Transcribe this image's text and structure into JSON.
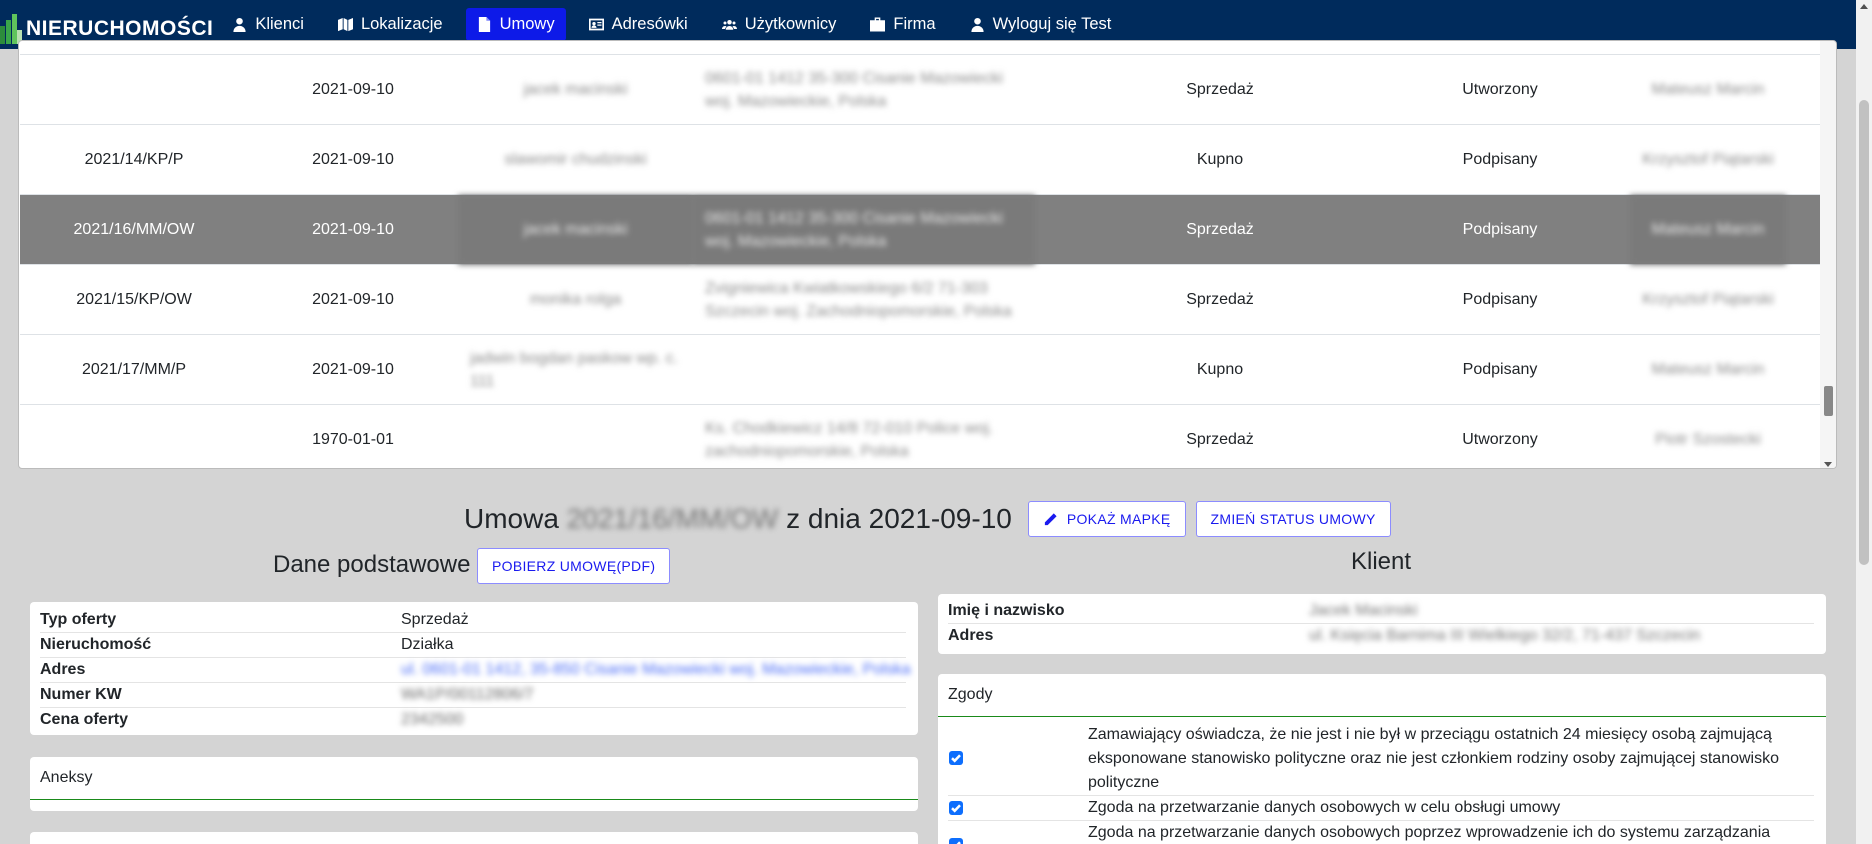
{
  "nav": {
    "brand": "NIERUCHOMOŚCI",
    "items": [
      {
        "label": "Klienci",
        "icon": "user-icon"
      },
      {
        "label": "Lokalizacje",
        "icon": "map-icon"
      },
      {
        "label": "Umowy",
        "icon": "file-icon",
        "active": true
      },
      {
        "label": "Adresówki",
        "icon": "address-card-icon"
      },
      {
        "label": "Użytkownicy",
        "icon": "users-icon"
      },
      {
        "label": "Firma",
        "icon": "briefcase-icon"
      },
      {
        "label": "Wyloguj się Test",
        "icon": "user-icon"
      }
    ]
  },
  "table": {
    "rows": [
      {
        "number": "",
        "date": "2021-09-10",
        "client": "jacek macinski",
        "address": "0601-01 1412 35-300 Cisanie Mazowiecki woj. Mazowieckie, Polska",
        "type": "Sprzedaż",
        "status": "Utworzony",
        "agent": "Mateusz Marcin"
      },
      {
        "number": "2021/14/KP/P",
        "date": "2021-09-10",
        "client": "slawomir chudzinski",
        "address": "",
        "type": "Kupno",
        "status": "Podpisany",
        "agent": "Krzysztof Piątarski"
      },
      {
        "number": "2021/16/MM/OW",
        "date": "2021-09-10",
        "client": "jacek macinski",
        "address": "0601-01 1412 35-300 Cisanie Mazowiecki woj. Mazowieckie, Polska",
        "type": "Sprzedaż",
        "status": "Podpisany",
        "agent": "Mateusz Marcin",
        "selected": true
      },
      {
        "number": "2021/15/KP/OW",
        "date": "2021-09-10",
        "client": "monika rolga",
        "address": "Zvigniewica Kwiatkowskiego 6/2 71-303 Szczecin woj. Zachodniopomorskie, Polska",
        "type": "Sprzedaż",
        "status": "Podpisany",
        "agent": "Krzysztof Piątarski"
      },
      {
        "number": "2021/17/MM/P",
        "date": "2021-09-10",
        "client": "jadwin bogdan paskow wp. c. 111",
        "address": "",
        "type": "Kupno",
        "status": "Podpisany",
        "agent": "Mateusz Marcin"
      },
      {
        "number": "",
        "date": "1970-01-01",
        "client": "",
        "address": "Ks. Chodkiewicz 14/8 72-010 Police woj. zachodniopomorskie, Polska",
        "type": "Sprzedaż",
        "status": "Utworzony",
        "agent": "Piotr Szostecki"
      }
    ]
  },
  "detail": {
    "title_prefix": "Umowa",
    "title_number": "2021/16/MM/OW",
    "title_suffix": "z dnia 2021-09-10",
    "show_map_button": "POKAŻ MAPKĘ",
    "change_status_button": "ZMIEŃ STATUS UMOWY",
    "basic_heading": "Dane podstawowe",
    "download_button": "POBIERZ UMOWĘ(PDF)",
    "client_heading": "Klient",
    "basic": [
      {
        "label": "Typ oferty",
        "value": "Sprzedaż"
      },
      {
        "label": "Nieruchomość",
        "value": "Działka"
      },
      {
        "label": "Adres",
        "value": "ul. 0601-01 1412, 35-850 Cisanie Mazowiecki woj. Mazowieckie, Polska"
      },
      {
        "label": "Numer KW",
        "value": "WA1P/00112806/7"
      },
      {
        "label": "Cena oferty",
        "value": "2342500"
      }
    ],
    "annex_label": "Aneksy",
    "client": [
      {
        "label": "Imię i nazwisko",
        "value": "Jacek Macinski"
      },
      {
        "label": "Adres",
        "value": "ul. Księcia Barnima III Wielkiego 32/2, 71-437 Szczecin"
      }
    ],
    "consents_label": "Zgody",
    "consents": [
      "Zamawiający oświadcza, że nie jest i nie był w przeciągu ostatnich 24 miesięcy osobą zajmującą eksponowane stanowisko polityczne oraz nie jest członkiem rodziny osoby zajmującej stanowisko polityczne",
      "Zgoda na przetwarzanie danych osobowych w celu obsługi umowy",
      "Zgoda na przetwarzanie danych osobowych poprzez wprowadzenie ich do systemu zarządzania"
    ]
  },
  "colors": {
    "navbar": "#002b5c",
    "active_nav": "#0d1ae8",
    "selected_row": "#808080",
    "accent_line": "#1a8a1a",
    "link": "#1a1aef"
  }
}
